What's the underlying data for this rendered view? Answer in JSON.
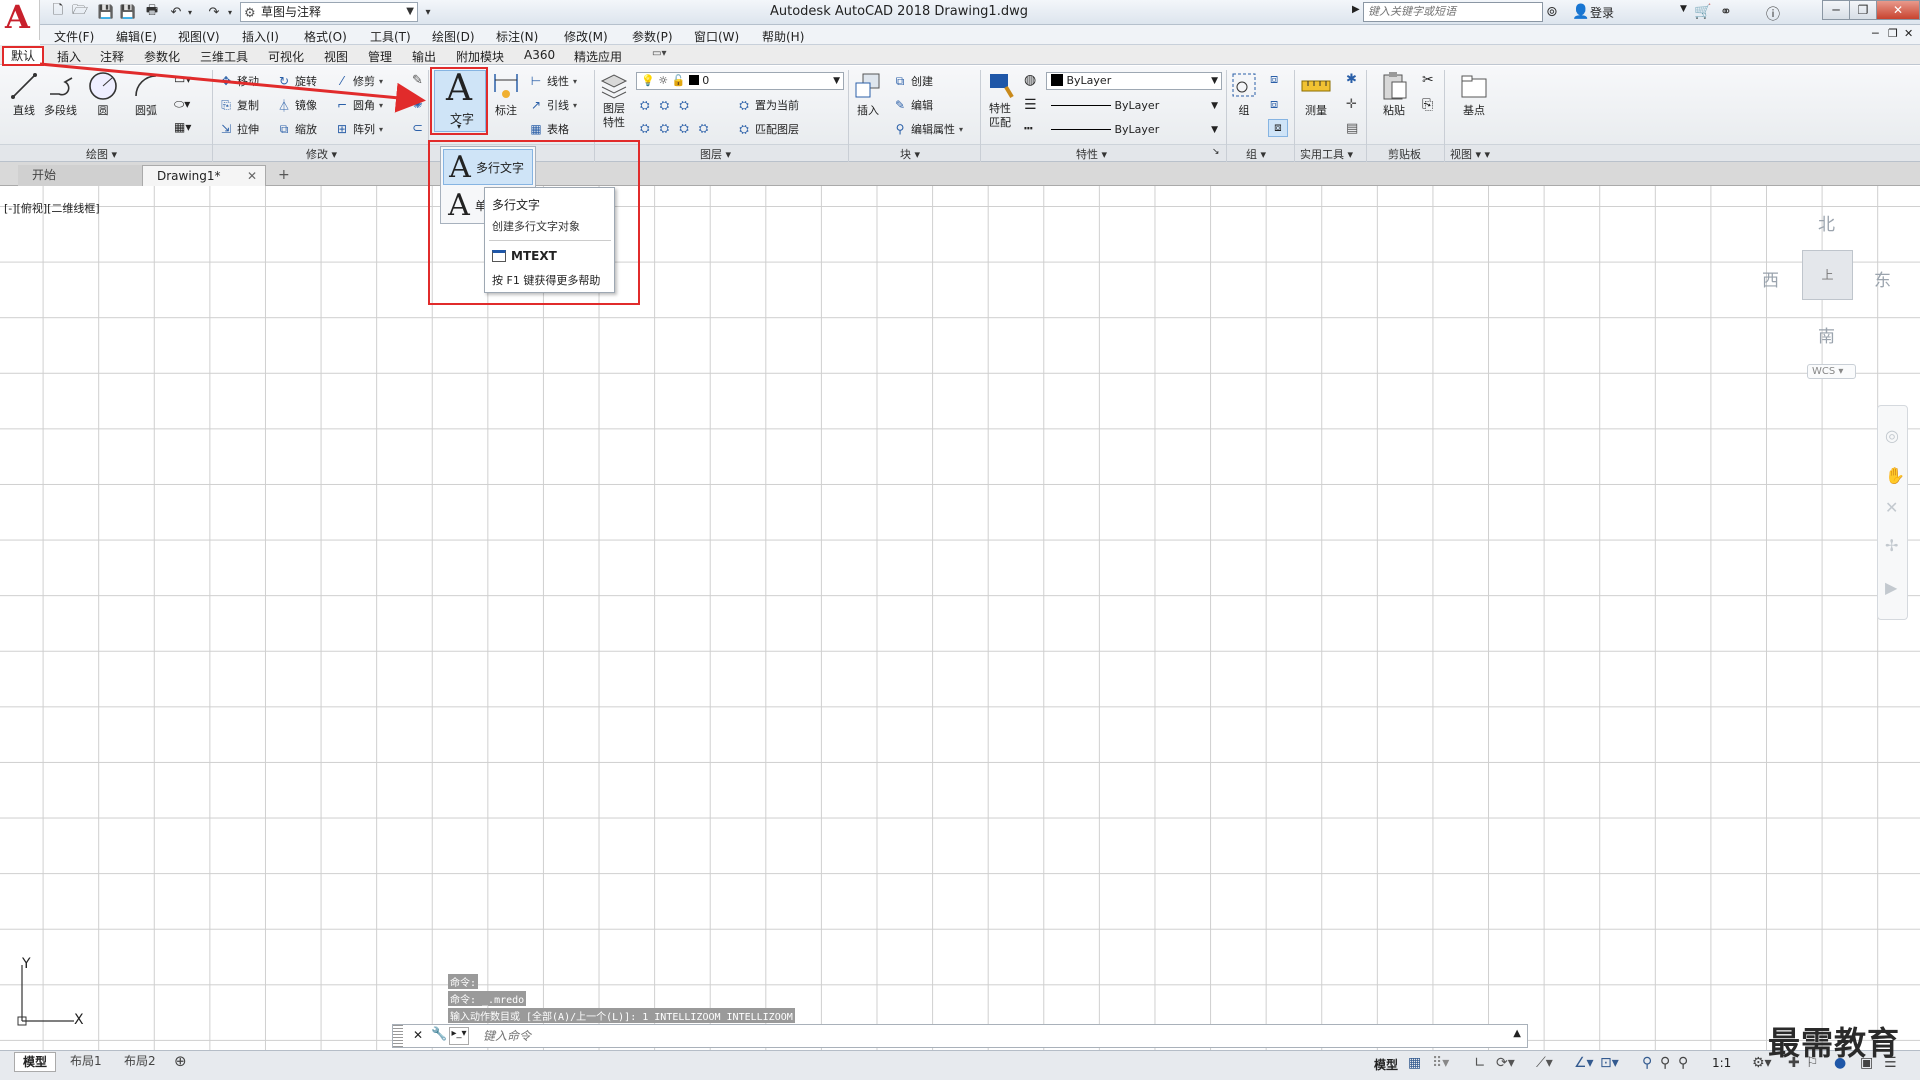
{
  "titlebar": {
    "title": "Autodesk AutoCAD 2018    Drawing1.dwg",
    "logo_letter": "A",
    "workspace": "草图与注释",
    "search_placeholder": "键入关键字或短语",
    "login": "登录"
  },
  "menu": [
    "文件(F)",
    "编辑(E)",
    "视图(V)",
    "插入(I)",
    "格式(O)",
    "工具(T)",
    "绘图(D)",
    "标注(N)",
    "修改(M)",
    "参数(P)",
    "窗口(W)",
    "帮助(H)"
  ],
  "ribbon_tabs": [
    "默认",
    "插入",
    "注释",
    "参数化",
    "三维工具",
    "可视化",
    "视图",
    "管理",
    "输出",
    "附加模块",
    "A360",
    "精选应用"
  ],
  "draw_panel": {
    "label": "绘图",
    "buttons": [
      "直线",
      "多段线",
      "圆",
      "圆弧"
    ]
  },
  "modify_panel": {
    "label": "修改",
    "items": [
      "移动",
      "旋转",
      "修剪",
      "复制",
      "镜像",
      "圆角",
      "拉伸",
      "缩放",
      "阵列"
    ]
  },
  "annotation_panel": {
    "text_button": "文字",
    "dim_button": "标注",
    "items": [
      "线性",
      "引线",
      "表格"
    ]
  },
  "layers_panel": {
    "label": "图层",
    "button": "图层特性",
    "layer": "0",
    "items": [
      "置为当前",
      "匹配图层"
    ]
  },
  "block_panel": {
    "label": "块",
    "insert": "插入",
    "items": [
      "创建",
      "编辑",
      "编辑属性"
    ]
  },
  "properties_panel": {
    "label": "特性",
    "match": "特性匹配",
    "color": "ByLayer",
    "linetype": "ByLayer",
    "lineweight": "ByLayer"
  },
  "group_panel": {
    "label": "组",
    "button": "组"
  },
  "utilities_panel": {
    "label": "实用工具",
    "measure": "测量"
  },
  "clipboard_panel": {
    "label": "剪贴板",
    "paste": "粘贴"
  },
  "view_panel": {
    "label": "视图",
    "base": "基点"
  },
  "text_dropdown": {
    "mtext": "多行文字",
    "single_short": "单"
  },
  "tooltip": {
    "title": "多行文字",
    "desc": "创建多行文字对象",
    "command": "MTEXT",
    "help": "按 F1 键获得更多帮助"
  },
  "doc_tabs": {
    "start": "开始",
    "drawing": "Drawing1*",
    "add": "+"
  },
  "viewport_label": "[-][俯视][二维线框]",
  "viewcube": {
    "north": "北",
    "south": "南",
    "east": "东",
    "west": "西",
    "face": "上",
    "wcs": "WCS"
  },
  "ucs": {
    "x": "X",
    "y": "Y"
  },
  "command": {
    "history": [
      "命令:",
      "命令: _.mredo",
      "输入动作数目或 [全部(A)/上一个(L)]: 1 INTELLIZOOM INTELLIZOOM"
    ],
    "placeholder": "键入命令"
  },
  "layout_tabs": [
    "模型",
    "布局1",
    "布局2"
  ],
  "status": {
    "model": "模型",
    "scale": "1:1"
  },
  "watermark": "最需教育"
}
